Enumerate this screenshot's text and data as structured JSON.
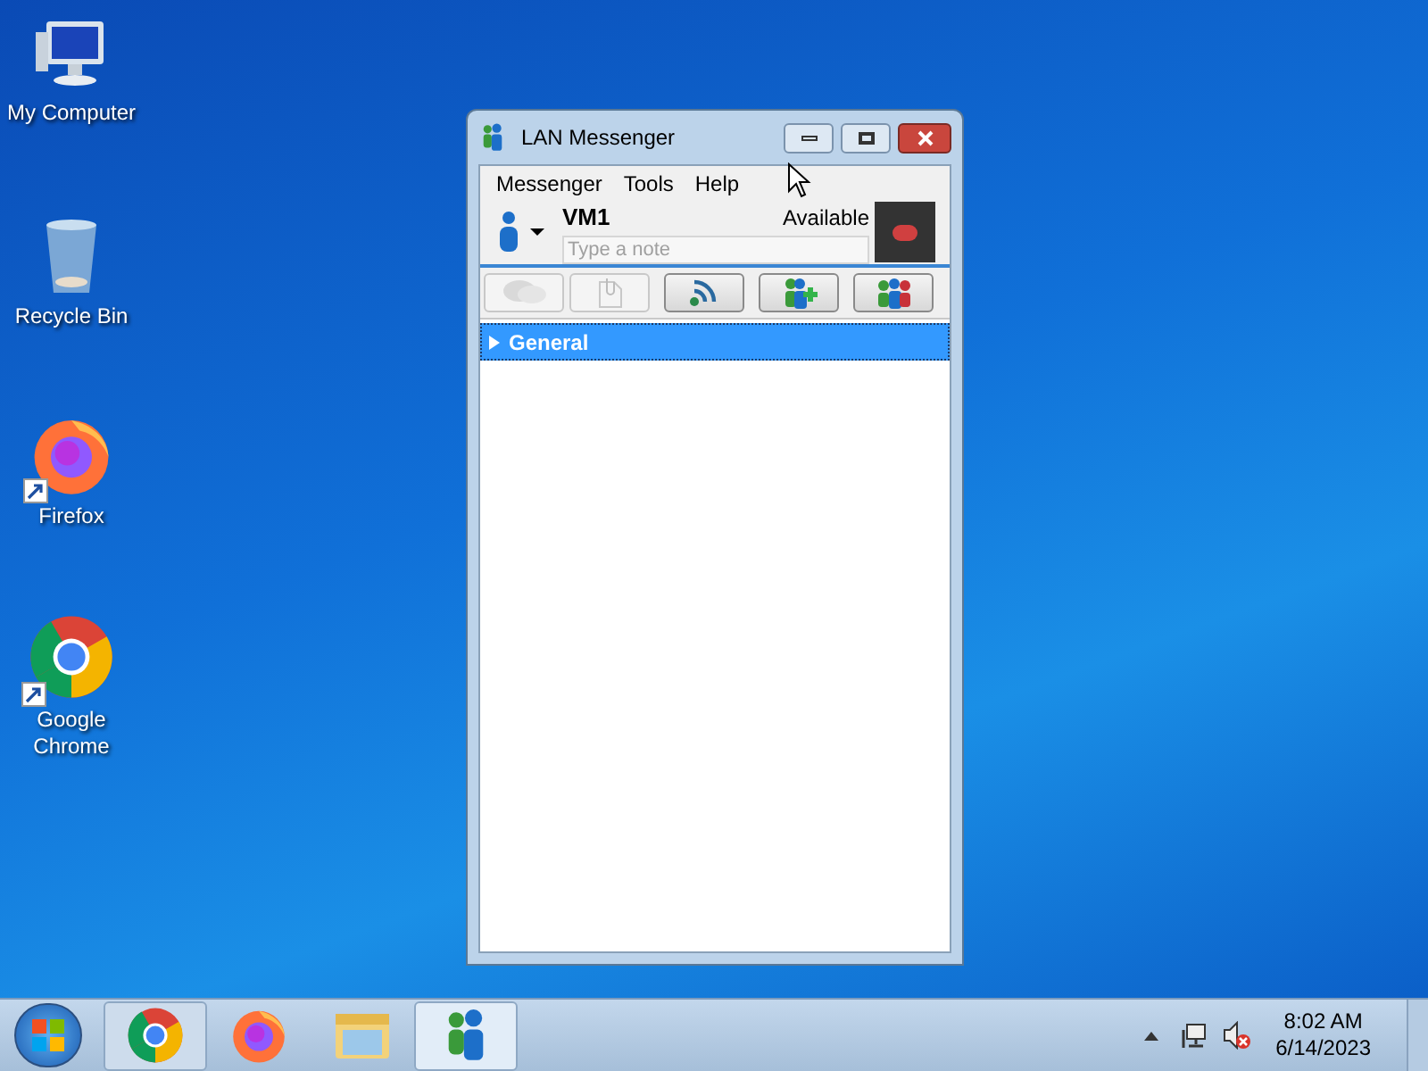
{
  "desktop_icons": [
    {
      "kind": "computer",
      "label": "My Computer"
    },
    {
      "kind": "recycle",
      "label": "Recycle Bin"
    },
    {
      "kind": "firefox",
      "label": "Firefox"
    },
    {
      "kind": "chrome",
      "label": "Google Chrome"
    }
  ],
  "window": {
    "title": "LAN Messenger",
    "menu": [
      "Messenger",
      "Tools",
      "Help"
    ],
    "user": {
      "name": "VM1",
      "status": "Available",
      "note_placeholder": "Type a note"
    },
    "toolbar": [
      {
        "kind": "chat",
        "disabled": true
      },
      {
        "kind": "file",
        "disabled": true
      },
      {
        "kind": "broadcast",
        "disabled": false
      },
      {
        "kind": "add-user",
        "disabled": false
      },
      {
        "kind": "users",
        "disabled": false
      }
    ],
    "groups": [
      {
        "name": "General",
        "expanded": false,
        "selected": true
      }
    ]
  },
  "taskbar": {
    "apps": [
      {
        "kind": "chrome",
        "running": true,
        "selected": false
      },
      {
        "kind": "firefox",
        "running": false,
        "selected": false
      },
      {
        "kind": "explorer",
        "running": false,
        "selected": false
      },
      {
        "kind": "messenger",
        "running": true,
        "selected": true
      }
    ],
    "time": "8:02 AM",
    "date": "6/14/2023"
  }
}
